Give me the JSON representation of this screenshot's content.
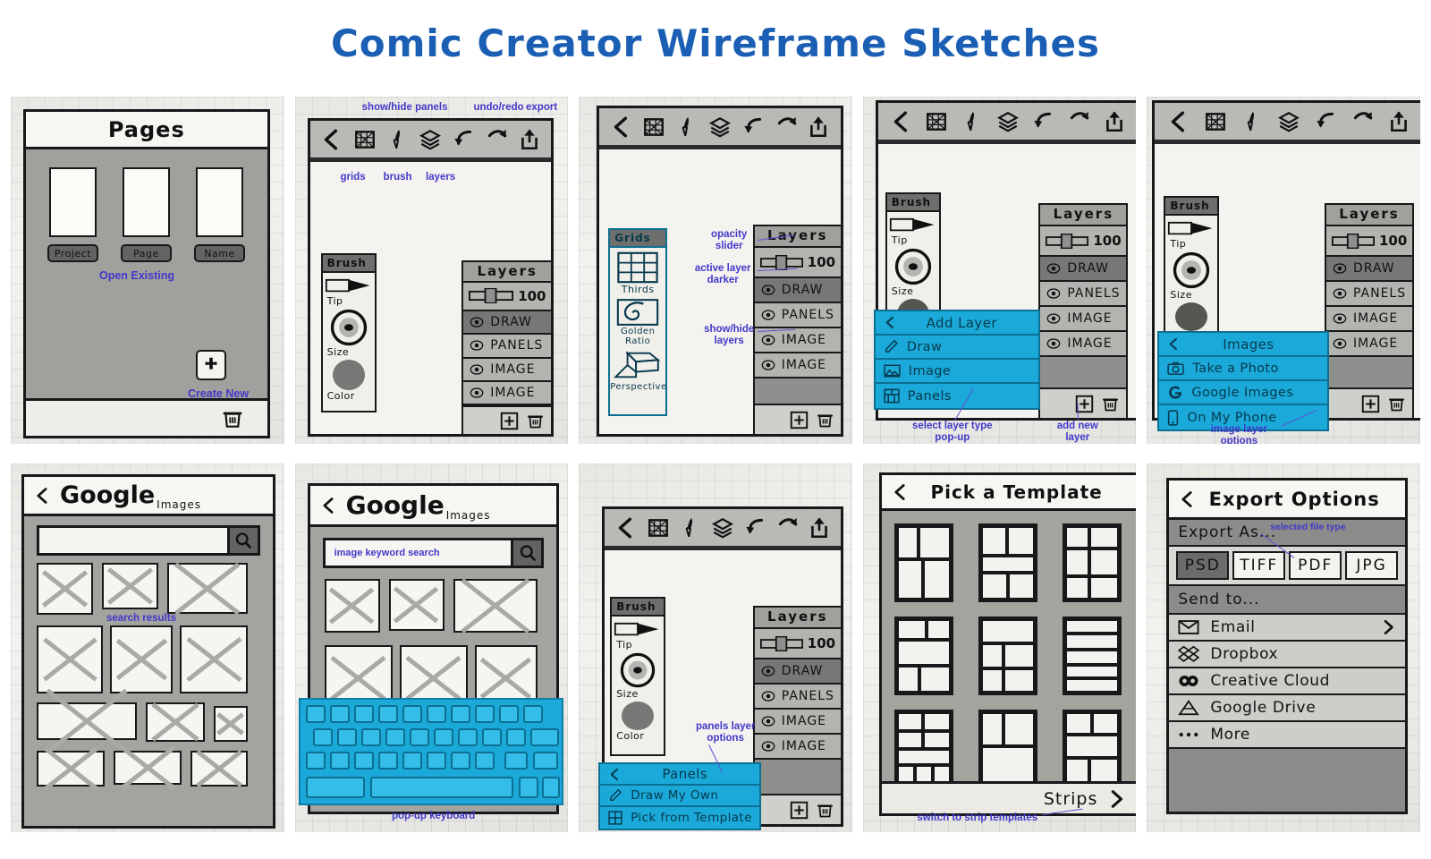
{
  "page": {
    "title": "Comic Creator Wireframe Sketches"
  },
  "accent": {
    "annotation": "#4338c9",
    "cyan": "#1aa9d8",
    "title_blue": "#1a5fb4"
  },
  "toolbar": {
    "icons": [
      "back-chevron-icon",
      "grid-icon",
      "brush-icon",
      "layers-icon",
      "undo-icon",
      "redo-icon",
      "export-icon"
    ]
  },
  "common": {
    "brush": {
      "title": "Brush",
      "tip": "Tip",
      "size": "Size",
      "color": "Color"
    },
    "layers": {
      "title": "Layers",
      "opacity": "100",
      "rows": [
        "DRAW",
        "PANELS",
        "IMAGE",
        "IMAGE"
      ],
      "active_index": 0,
      "add_icon": "add-layer-icon",
      "delete_icon": "trash-icon"
    }
  },
  "frames": [
    {
      "id": "pages",
      "name": "pages-screen",
      "header": "Pages",
      "thumb_labels": [
        "Project",
        "Page",
        "Name"
      ],
      "annotations": [
        {
          "text": "Open Existing"
        },
        {
          "text": "Create New"
        }
      ],
      "create_icon": "plus-icon",
      "trash_icon": "trash-icon"
    },
    {
      "id": "editor",
      "name": "editor-screen",
      "annotations": [
        {
          "text": "show/hide panels"
        },
        {
          "text": "undo/redo"
        },
        {
          "text": "export"
        },
        {
          "text": "grids"
        },
        {
          "text": "brush"
        },
        {
          "text": "layers"
        }
      ]
    },
    {
      "id": "grids",
      "name": "grids-screen",
      "panel": {
        "title": "Grids",
        "options": [
          {
            "label": "Thirds",
            "icon": "thirds-grid-icon"
          },
          {
            "label": "Golden Ratio",
            "icon": "golden-spiral-icon"
          },
          {
            "label": "Perspective",
            "icon": "perspective-box-icon"
          }
        ]
      },
      "annotations": [
        {
          "text": "opacity\nslider"
        },
        {
          "text": "active layer\ndarker"
        },
        {
          "text": "show/hide\nlayers"
        }
      ]
    },
    {
      "id": "add-layer",
      "name": "add-layer-screen",
      "popup": {
        "title": "Add Layer",
        "back_icon": "back-chevron-icon",
        "items": [
          {
            "label": "Draw",
            "icon": "pencil-icon"
          },
          {
            "label": "Image",
            "icon": "photo-icon"
          },
          {
            "label": "Panels",
            "icon": "panels-grid-icon"
          }
        ]
      },
      "annotations": [
        {
          "text": "select layer type\npop-up"
        },
        {
          "text": "add new\nlayer"
        }
      ]
    },
    {
      "id": "images",
      "name": "image-source-screen",
      "popup": {
        "title": "Images",
        "back_icon": "back-chevron-icon",
        "items": [
          {
            "label": "Take a Photo",
            "icon": "camera-icon"
          },
          {
            "label": "Google Images",
            "icon": "google-g-icon"
          },
          {
            "label": "On My Phone",
            "icon": "phone-icon"
          }
        ]
      },
      "annotations": [
        {
          "text": "image layer\noptions"
        }
      ]
    },
    {
      "id": "google-results",
      "name": "google-images-results-screen",
      "header": {
        "brand": "Google",
        "sub": "Images",
        "back_icon": "back-chevron-icon"
      },
      "search": {
        "value": "",
        "icon": "search-icon"
      },
      "annotations": [
        {
          "text": "search results"
        }
      ]
    },
    {
      "id": "google-search",
      "name": "google-images-search-screen",
      "header": {
        "brand": "Google",
        "sub": "Images",
        "back_icon": "back-chevron-icon"
      },
      "search": {
        "placeholder": "image keyword search",
        "icon": "search-icon"
      },
      "annotations": [
        {
          "text": "pop-up keyboard"
        }
      ]
    },
    {
      "id": "panels-layer",
      "name": "panels-layer-screen",
      "popup": {
        "title": "Panels",
        "back_icon": "back-chevron-icon",
        "items": [
          {
            "label": "Draw My Own",
            "icon": "pencil-icon"
          },
          {
            "label": "Pick from Template",
            "icon": "template-grid-icon"
          }
        ]
      },
      "annotations": [
        {
          "text": "panels layer\noptions"
        }
      ]
    },
    {
      "id": "templates",
      "name": "pick-template-screen",
      "header": "Pick a Template",
      "footer": {
        "label": "Strips",
        "icon": "chevron-right-icon"
      },
      "annotations": [
        {
          "text": "switch to strip templates"
        }
      ],
      "templates": [
        {
          "id": "t1",
          "cells": [
            [
              0,
              0,
              40,
              45
            ],
            [
              40,
              0,
              60,
              45
            ],
            [
              0,
              45,
              48,
              55
            ],
            [
              48,
              45,
              52,
              55
            ]
          ]
        },
        {
          "id": "t2",
          "cells": [
            [
              0,
              0,
              48,
              40
            ],
            [
              48,
              0,
              52,
              40
            ],
            [
              0,
              40,
              100,
              24
            ],
            [
              0,
              64,
              50,
              36
            ],
            [
              50,
              64,
              50,
              36
            ]
          ]
        },
        {
          "id": "t3",
          "cells": [
            [
              0,
              0,
              46,
              30
            ],
            [
              46,
              0,
              54,
              30
            ],
            [
              0,
              30,
              46,
              38
            ],
            [
              46,
              30,
              54,
              38
            ],
            [
              0,
              68,
              46,
              32
            ],
            [
              46,
              68,
              54,
              32
            ]
          ]
        },
        {
          "id": "t4",
          "cells": [
            [
              0,
              0,
              55,
              28
            ],
            [
              55,
              0,
              45,
              28
            ],
            [
              0,
              28,
              100,
              36
            ],
            [
              0,
              64,
              42,
              36
            ],
            [
              42,
              64,
              58,
              36
            ]
          ]
        },
        {
          "id": "t5",
          "cells": [
            [
              0,
              0,
              100,
              33
            ],
            [
              0,
              33,
              42,
              34
            ],
            [
              42,
              33,
              58,
              34
            ],
            [
              0,
              67,
              42,
              33
            ],
            [
              42,
              67,
              58,
              33
            ]
          ]
        },
        {
          "id": "t6",
          "cells": [
            [
              0,
              0,
              100,
              20
            ],
            [
              0,
              20,
              100,
              22
            ],
            [
              0,
              42,
              100,
              20
            ],
            [
              0,
              62,
              100,
              19
            ],
            [
              0,
              81,
              100,
              19
            ]
          ]
        },
        {
          "id": "t7",
          "cells": [
            [
              0,
              0,
              48,
              26
            ],
            [
              48,
              0,
              52,
              26
            ],
            [
              0,
              26,
              48,
              24
            ],
            [
              48,
              26,
              52,
              24
            ],
            [
              0,
              50,
              100,
              22
            ],
            [
              0,
              72,
              33,
              28
            ],
            [
              33,
              72,
              34,
              28
            ],
            [
              67,
              72,
              33,
              28
            ]
          ]
        },
        {
          "id": "t8",
          "cells": [
            [
              0,
              0,
              42,
              46
            ],
            [
              42,
              0,
              58,
              46
            ],
            [
              0,
              46,
              100,
              54
            ]
          ]
        },
        {
          "id": "t9",
          "cells": [
            [
              0,
              0,
              50,
              30
            ],
            [
              50,
              0,
              50,
              30
            ],
            [
              0,
              30,
              100,
              32
            ],
            [
              0,
              62,
              46,
              38
            ],
            [
              46,
              62,
              54,
              38
            ]
          ]
        }
      ]
    },
    {
      "id": "export",
      "name": "export-options-screen",
      "header": "Export Options",
      "back_icon": "back-chevron-icon",
      "export_as_label": "Export As...",
      "file_types": [
        "PSD",
        "TIFF",
        "PDF",
        "JPG"
      ],
      "selected_file_type": "PSD",
      "send_to_label": "Send to...",
      "send_to": [
        {
          "label": "Email",
          "icon": "envelope-icon",
          "chevron": true
        },
        {
          "label": "Dropbox",
          "icon": "dropbox-icon",
          "chevron": false
        },
        {
          "label": "Creative Cloud",
          "icon": "creative-cloud-icon",
          "chevron": false
        },
        {
          "label": "Google Drive",
          "icon": "google-drive-icon",
          "chevron": false
        },
        {
          "label": "More",
          "icon": "ellipsis-icon",
          "chevron": false
        }
      ],
      "annotations": [
        {
          "text": "selected file type"
        }
      ]
    }
  ]
}
